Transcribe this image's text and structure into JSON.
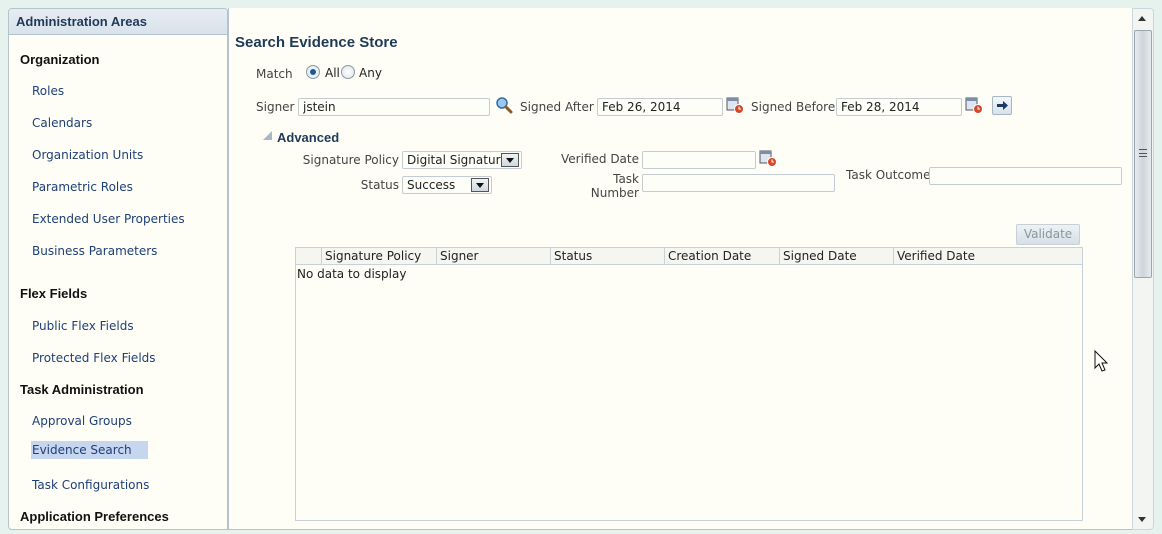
{
  "sidebar": {
    "header": "Administration Areas",
    "sections": [
      {
        "title": "Organization",
        "items": [
          "Roles",
          "Calendars",
          "Organization Units",
          "Parametric Roles",
          "Extended User Properties",
          "Business Parameters"
        ]
      },
      {
        "title": "Flex Fields",
        "items": [
          "Public Flex Fields",
          "Protected Flex Fields"
        ]
      },
      {
        "title": "Task Administration",
        "items": [
          "Approval Groups",
          "Evidence Search",
          "Task Configurations"
        ]
      },
      {
        "title": "Application Preferences",
        "items": []
      }
    ],
    "selected_item": "Evidence Search"
  },
  "search": {
    "title": "Search Evidence Store",
    "match_label": "Match",
    "match_options": [
      "All",
      "Any"
    ],
    "match_selected": "All",
    "signer_label": "Signer",
    "signer_value": "jstein",
    "signed_after_label": "Signed After",
    "signed_after_value": "Feb 26, 2014",
    "signed_before_label": "Signed Before",
    "signed_before_value": "Feb 28, 2014",
    "advanced_label": "Advanced",
    "signature_policy_label": "Signature Policy",
    "signature_policy_value": "Digital Signature",
    "status_label": "Status",
    "status_value": "Success",
    "verified_date_label": "Verified Date",
    "verified_date_value": "",
    "task_number_label_1": "Task",
    "task_number_label_2": "Number",
    "task_number_value": "",
    "task_outcome_label": "Task Outcome",
    "task_outcome_value": ""
  },
  "results": {
    "validate_label": "Validate",
    "columns": [
      "Signature Policy",
      "Signer",
      "Status",
      "Creation Date",
      "Signed Date",
      "Verified Date"
    ],
    "empty_text": "No data to display"
  },
  "colors": {
    "accent": "#1f3a59",
    "link": "#1f3f77",
    "selected_bg": "#c5d6ee",
    "panel_bg": "#fefef6"
  }
}
